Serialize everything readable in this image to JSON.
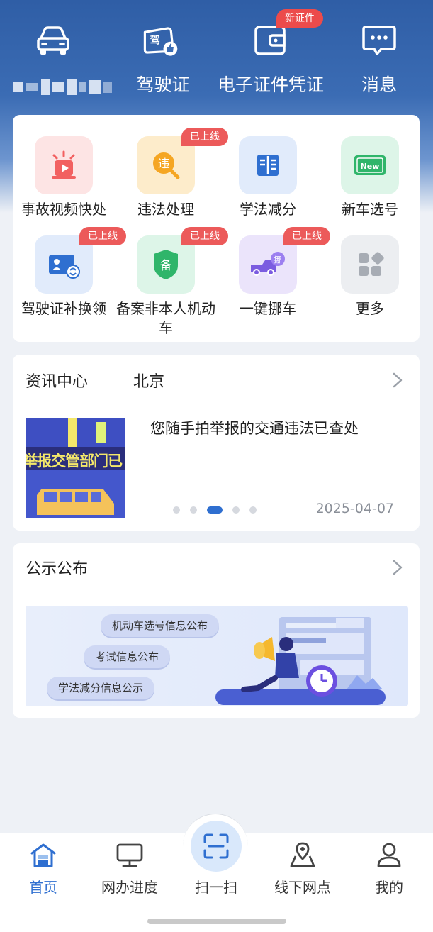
{
  "colors": {
    "header_blue": "#2f5ea6",
    "accent_blue": "#2f6fd0",
    "badge_red": "#ec5a5a",
    "page_bg": "#eef1f6"
  },
  "header": {
    "items": [
      {
        "label": "",
        "icon": "car-icon"
      },
      {
        "label": "驾驶证",
        "icon": "driver-license-icon"
      },
      {
        "label": "电子证件凭证",
        "icon": "wallet-icon",
        "badge": "新证件"
      },
      {
        "label": "消息",
        "icon": "message-icon"
      }
    ]
  },
  "services": [
    {
      "label": "事故视频快处",
      "icon": "accident-video-icon",
      "badge": ""
    },
    {
      "label": "违法处理",
      "icon": "violation-icon",
      "badge": "已上线",
      "glyph": "违"
    },
    {
      "label": "学法减分",
      "icon": "study-book-icon",
      "badge": ""
    },
    {
      "label": "新车选号",
      "icon": "new-plate-icon",
      "badge": "",
      "glyph": "New"
    },
    {
      "label": "驾驶证补换领",
      "icon": "license-replace-icon",
      "badge": "已上线"
    },
    {
      "label": "备案非本人机动车",
      "icon": "register-shield-icon",
      "badge": "已上线",
      "glyph": "备"
    },
    {
      "label": "一键挪车",
      "icon": "move-car-icon",
      "badge": "已上线",
      "glyph": "挪"
    },
    {
      "label": "更多",
      "icon": "more-grid-icon",
      "badge": ""
    }
  ],
  "news": {
    "section_title": "资讯中心",
    "city": "北京",
    "headline": "您随手拍举报的交通违法已查处",
    "thumb_text": "举报交管部门已",
    "date": "2025-04-07",
    "carousel_index": 3,
    "carousel_total": 5
  },
  "notice": {
    "section_title": "公示公布",
    "pills": [
      "机动车选号信息公布",
      "考试信息公布",
      "学法减分信息公示"
    ]
  },
  "tabbar": {
    "tabs": [
      {
        "label": "首页",
        "icon": "home-icon",
        "active": true
      },
      {
        "label": "网办进度",
        "icon": "monitor-icon",
        "active": false
      },
      {
        "label": "扫一扫",
        "icon": "scan-icon",
        "active": false
      },
      {
        "label": "线下网点",
        "icon": "location-map-icon",
        "active": false
      },
      {
        "label": "我的",
        "icon": "user-icon",
        "active": false
      }
    ]
  }
}
